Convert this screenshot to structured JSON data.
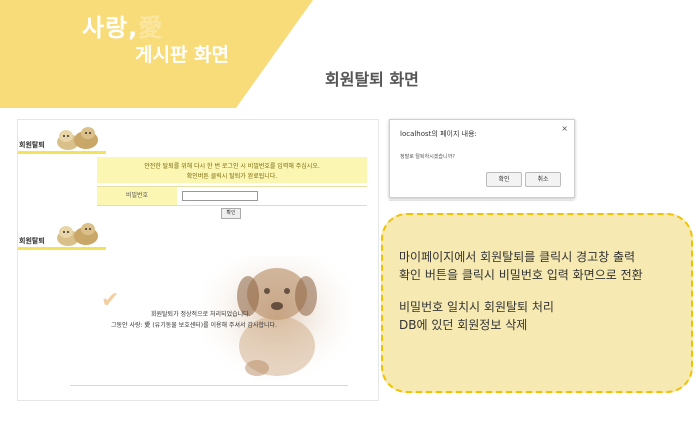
{
  "banner": {
    "title": "사랑,",
    "title_love": "愛",
    "subtitle": "게시판 화면"
  },
  "page_heading": "회원탈퇴 화면",
  "screenshot": {
    "section1_label": "회원탈퇴",
    "notice_line1": "안전한 탈퇴를 위해 다시 한 번 로그인 시 비밀번호를 입력해 주십시오.",
    "notice_line2": "확인버튼 클릭시 탈퇴가 완료됩니다.",
    "password_label": "비밀번호",
    "password_value": "",
    "confirm_label": "확인",
    "section2_label": "회원탈퇴",
    "done_message": "회원탈퇴가 정상적으로 처리되었습니다.",
    "thanks_message": "그동안 사랑: 愛 (유기동물 보호센터)를 이용해 주셔서 감사합니다."
  },
  "dialog": {
    "title": "localhost의 페이지 내용:",
    "message": "정말로 탈퇴하시겠습니까?",
    "ok_label": "확인",
    "cancel_label": "취소",
    "close_glyph": "×"
  },
  "callout": {
    "line1": "마이페이지에서 회원탈퇴를 클릭시 경고창 출력",
    "line2": "확인 버튼을 클릭시 비밀번호 입력 화면으로 전환",
    "line3": "비밀번호 일치시 회원탈퇴 처리",
    "line4": "DB에 있던 회원정보 삭제"
  },
  "colors": {
    "banner": "#f8dc7a",
    "notice_bg": "#fbf6b2",
    "callout_bg": "#f6e9b2",
    "callout_border": "#f1c200",
    "tab_underline": "#f2e35a"
  }
}
